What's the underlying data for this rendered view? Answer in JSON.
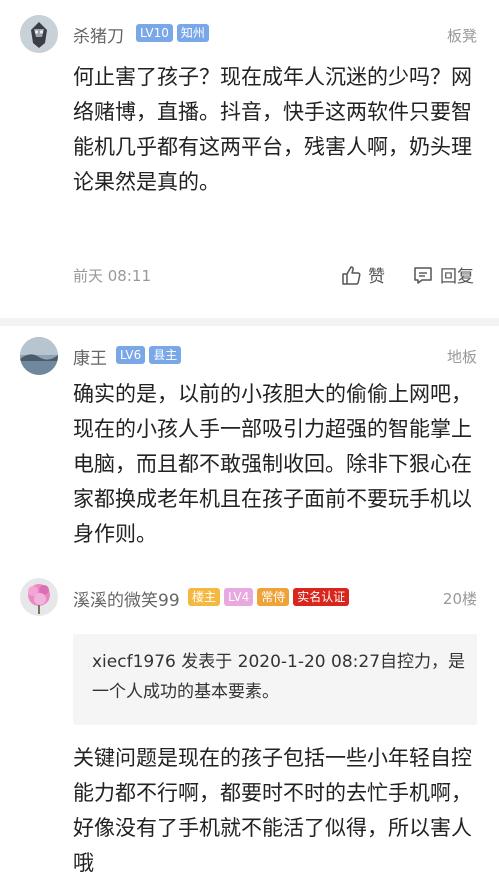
{
  "posts": [
    {
      "author": "杀猪刀",
      "badges": [
        {
          "text": "LV10",
          "color": "#7aa7e8"
        },
        {
          "text": "知州",
          "color": "#7aa7e8"
        }
      ],
      "floor": "板凳",
      "content": "何止害了孩子？现在成年人沉迷的少吗？网络赌博，直播。抖音，快手这两软件只要智能机几乎都有这两平台，残害人啊，奶头理论果然是真的。",
      "time": "前天 08:11",
      "like_label": "赞",
      "reply_label": "回复"
    },
    {
      "author": "康王",
      "badges": [
        {
          "text": "LV6",
          "color": "#7aa7e8"
        },
        {
          "text": "县主",
          "color": "#7aa7e8"
        }
      ],
      "floor": "地板",
      "content": "确实的是，以前的小孩胆大的偷偷上网吧，现在的小孩人手一部吸引力超强的智能掌上电脑，而且都不敢强制收回。除非下狠心在家都换成老年机且在孩子面前不要玩手机以身作则。"
    },
    {
      "author": "溪溪的微笑99",
      "badges": [
        {
          "text": "楼主",
          "color": "#f5b942"
        },
        {
          "text": "LV4",
          "color": "#e8a8e0"
        },
        {
          "text": "常侍",
          "color": "#f0a23a"
        },
        {
          "text": "实名认证",
          "color": "#d9261c"
        }
      ],
      "floor": "20楼",
      "quote": "xiecf1976 发表于 2020-1-20 08:27自控力，是一个人成功的基本要素。",
      "content": "关键问题是现在的孩子包括一些小年轻自控能力都不行啊，都要时不时的去忙手机啊，好像没有了手机就不能活了似得，所以害人哦"
    }
  ]
}
